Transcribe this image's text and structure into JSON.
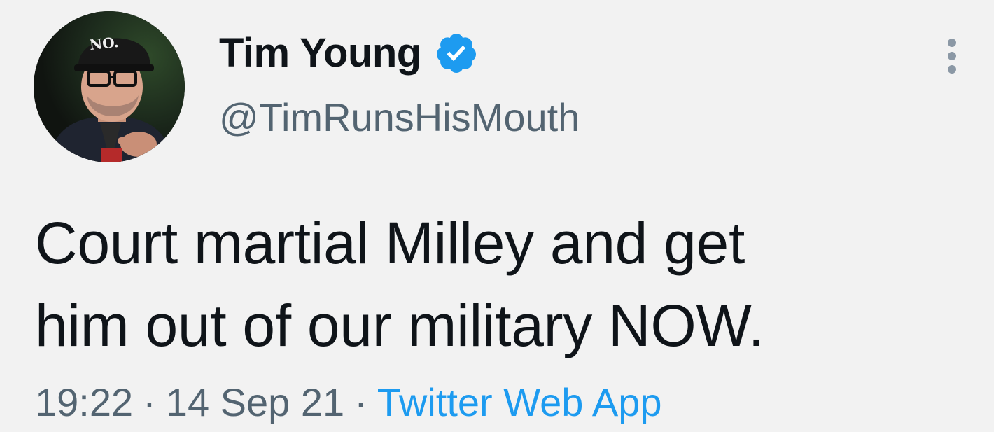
{
  "tweet": {
    "display_name": "Tim Young",
    "handle": "@TimRunsHisMouth",
    "verified": true,
    "hat_text": "NO.",
    "text_lines": [
      "Court martial Milley and get",
      "him out of our military NOW."
    ],
    "time": "19:22",
    "date": "14 Sep 21",
    "separator": "·",
    "source": "Twitter Web App"
  },
  "icons": {
    "verified": "verified-badge-icon",
    "more": "more-options-icon"
  },
  "colors": {
    "accent": "#1d9bf0",
    "text": "#0f1419",
    "secondary": "#536471",
    "background": "#f2f2f2"
  }
}
